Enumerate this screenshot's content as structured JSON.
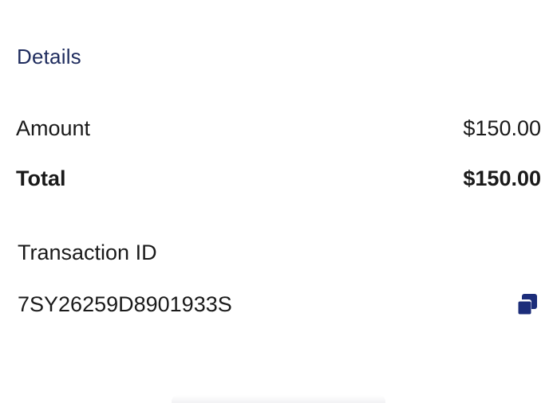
{
  "details": {
    "title": "Details",
    "amount_label": "Amount",
    "amount_value": "$150.00",
    "total_label": "Total",
    "total_value": "$150.00"
  },
  "transaction": {
    "label": "Transaction ID",
    "id": "7SY26259D8901933S",
    "copy_icon": "copy-icon"
  },
  "colors": {
    "title": "#1f2c5e",
    "icon": "#1c2d7a",
    "text": "#1a1a1a"
  }
}
